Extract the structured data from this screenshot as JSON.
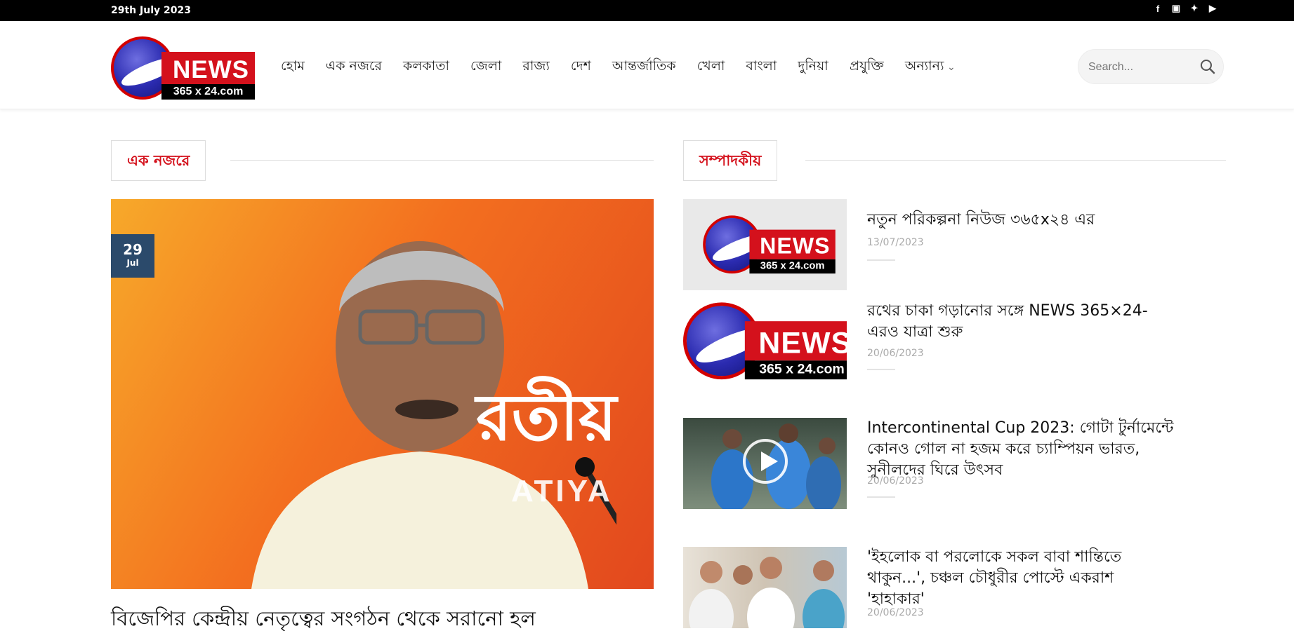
{
  "topbar": {
    "date": "29th July 2023",
    "social": [
      {
        "icon": "facebook-icon",
        "glyph": "f"
      },
      {
        "icon": "instagram-icon",
        "glyph": "▣"
      },
      {
        "icon": "twitter-icon",
        "glyph": "✦"
      },
      {
        "icon": "youtube-icon",
        "glyph": "▶"
      }
    ]
  },
  "logo": {
    "news": "NEWS",
    "sub": "365 x 24.com"
  },
  "nav": {
    "items": [
      "হোম",
      "এক নজরে",
      "কলকাতা",
      "জেলা",
      "রাজ্য",
      "দেশ",
      "আন্তর্জাতিক",
      "খেলা",
      "বাংলা",
      "দুনিয়া",
      "প্রযুক্তি",
      "অন্যান্য"
    ]
  },
  "search": {
    "placeholder": "Search..."
  },
  "left_section": {
    "heading": "এক নজরে",
    "featured": {
      "day": "29",
      "month": "Jul",
      "image_text": "রতীয়",
      "image_text2": "ATIYA",
      "title": "বিজেপির কেন্দ্রীয় নেতৃত্বের সংগঠন থেকে সরানো হল"
    }
  },
  "right_section": {
    "heading": "সম্পাদকীয়",
    "items": [
      {
        "title": "নতুন পরিকল্পনা নিউজ ৩৬৫x২৪ এর",
        "date": "13/07/2023"
      },
      {
        "title": "রথের চাকা গড়ানোর সঙ্গে NEWS 365×24-এরও যাত্রা শুরু",
        "date": "20/06/2023"
      },
      {
        "title": "Intercontinental Cup 2023: গোটা টুর্নামেন্টে কোনও গোল না হজম করে চ্যাম্পিয়ন ভারত, সুনীলদের ঘিরে উৎসব",
        "date": "20/06/2023"
      },
      {
        "title": "'ইহলোক বা পরলোকে সকল বাবা শান্তিতে থাকুন...', চঞ্চল চৌধুরীর পোস্টে একরাশ 'হাহাকার'",
        "date": "20/06/2023"
      }
    ]
  }
}
